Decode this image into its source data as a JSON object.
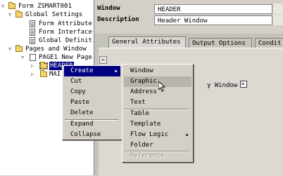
{
  "tree": {
    "form": "Form ZSMART001",
    "global_settings": "Global Settings",
    "form_attributes": "Form Attribute",
    "form_interface": "Form Interface",
    "global_definitions": "Global Definit",
    "pages_windows": "Pages and Window",
    "page1": "PAGE1 New Page",
    "header": "HEADER",
    "main": "MAI"
  },
  "fields": {
    "window_label": "Window",
    "window_value": "HEADER",
    "description_label": "Description",
    "description_value": "Header Window"
  },
  "tabs": [
    {
      "label": "General Attributes"
    },
    {
      "label": "Output Options"
    },
    {
      "label": "Condit"
    }
  ],
  "attr_tail": "y Window",
  "context_menu": {
    "items": [
      "Create",
      "Cut",
      "Copy",
      "Paste",
      "Delete",
      "Expand",
      "Collapse"
    ]
  },
  "create_submenu": {
    "items": [
      "Window",
      "Graphic",
      "Address",
      "Text",
      "Table",
      "Template",
      "Flow Logic",
      "Folder",
      "Reference"
    ]
  },
  "colors": {
    "selection": "#000080",
    "menu_bg": "#d4d0c8",
    "hover": "#b8b4aa"
  }
}
